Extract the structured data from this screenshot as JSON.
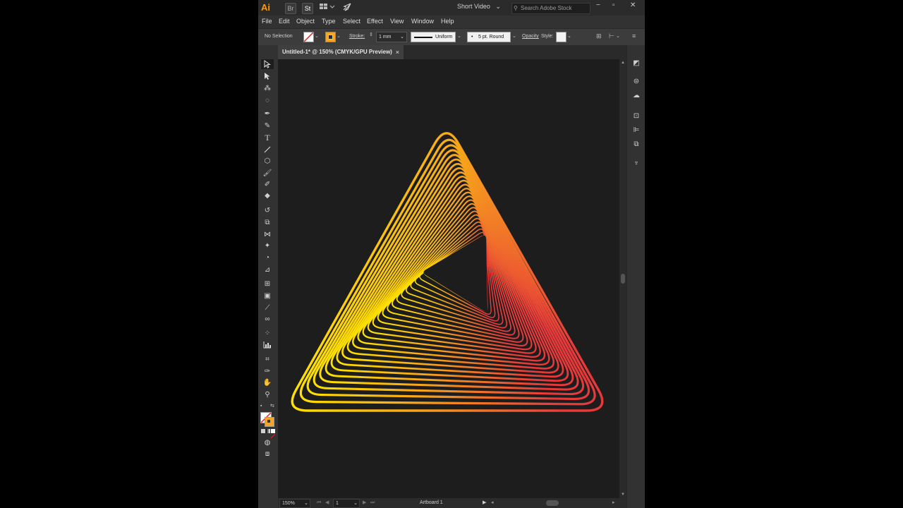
{
  "titlebar": {
    "app_logo": "Ai",
    "bridge": "Br",
    "stock": "St",
    "workspace": "Short Video",
    "search_placeholder": "Search Adobe Stock"
  },
  "menu": [
    "File",
    "Edit",
    "Object",
    "Type",
    "Select",
    "Effect",
    "View",
    "Window",
    "Help"
  ],
  "controlbar": {
    "selection": "No Selection",
    "stroke_label": "Stroke:",
    "stroke_weight": "1 mm",
    "profile": "Uniform",
    "brush": "5 pt. Round",
    "opacity_label": "Opacity",
    "style_label": "Style:"
  },
  "document": {
    "tab_title": "Untitled-1* @ 150% (CMYK/GPU Preview)",
    "close_symbol": "×"
  },
  "statusbar": {
    "zoom": "150%",
    "artboard_number": "1",
    "artboard_name": "Artboard 1"
  },
  "artwork": {
    "gradient_start": "#ffe000",
    "gradient_mid": "#f7a21b",
    "gradient_end": "#e8393a",
    "background": "#1d1d1d",
    "ring_count": 26
  },
  "icons": {
    "tools": [
      "selection-tool-icon",
      "direct-selection-tool-icon",
      "magic-wand-icon",
      "lasso-icon",
      "pen-tool-icon",
      "curvature-tool-icon",
      "type-tool-icon",
      "line-tool-icon",
      "shape-tool-icon",
      "paintbrush-icon",
      "shaper-tool-icon",
      "eraser-icon",
      "rotate-tool-icon",
      "scale-tool-icon",
      "width-tool-icon",
      "puppet-warp-icon",
      "shape-builder-icon",
      "perspective-grid-icon",
      "mesh-tool-icon",
      "gradient-tool-icon",
      "eyedropper-icon",
      "blend-tool-icon",
      "symbol-sprayer-icon",
      "graph-tool-icon",
      "artboard-tool-icon",
      "slice-tool-icon",
      "hand-tool-icon",
      "zoom-tool-icon"
    ],
    "dock": [
      "properties-panel-icon",
      "libraries-icon",
      "cc-libraries-icon",
      "transform-panel-icon",
      "align-panel-icon",
      "pathfinder-panel-icon",
      "puppet-panel-icon"
    ]
  }
}
